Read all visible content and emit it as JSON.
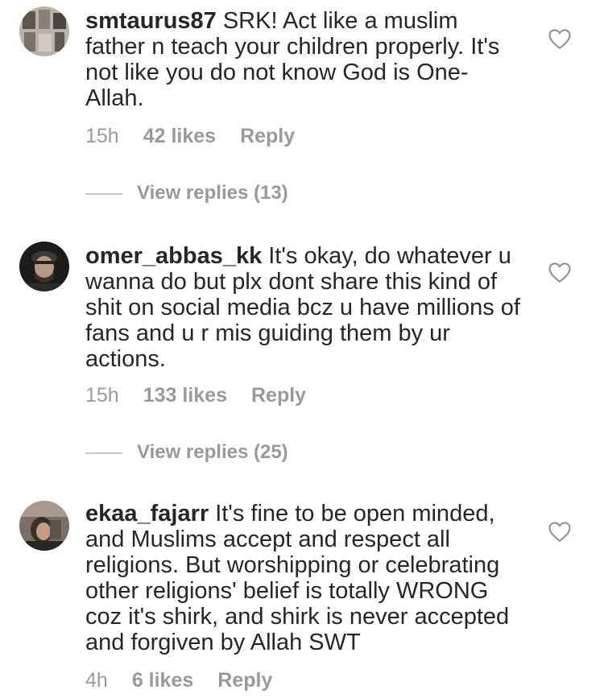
{
  "comments": [
    {
      "username": "smtaurus87",
      "text": "SRK! Act like a muslim father n teach your children properly. It's not like you do not know God is One- Allah.",
      "time": "15h",
      "likes": "42 likes",
      "reply": "Reply",
      "view_replies": "View replies (13)"
    },
    {
      "username": "omer_abbas_kk",
      "text": "It's okay, do whatever u wanna do but  plx dont share this kind of shit on social media bcz u have millions of fans and u r mis guiding them by ur actions.",
      "time": "15h",
      "likes": "133 likes",
      "reply": "Reply",
      "view_replies": "View replies (25)"
    },
    {
      "username": "ekaa_fajarr",
      "text": "It's fine to be open minded, and Muslims accept and respect all religions. But worshipping or celebrating other religions' belief is totally WRONG coz it's shirk, and shirk is never accepted and forgiven by Allah SWT",
      "time": "4h",
      "likes": "6 likes",
      "reply": "Reply"
    }
  ],
  "icons": {
    "like": "heart-outline-icon",
    "avatar": "profile-photo"
  },
  "colors": {
    "text": "#262626",
    "meta": "#999999",
    "divider": "#c7c7c7"
  }
}
